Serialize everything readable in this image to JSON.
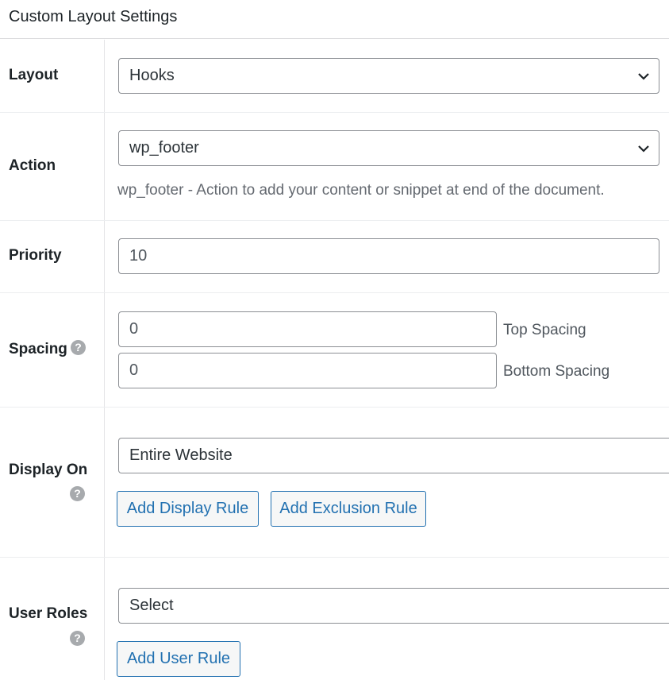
{
  "panel": {
    "title": "Custom Layout Settings"
  },
  "layout": {
    "label": "Layout",
    "value": "Hooks"
  },
  "action": {
    "label": "Action",
    "value": "wp_footer",
    "description": "wp_footer - Action to add your content or snippet at end of the document."
  },
  "priority": {
    "label": "Priority",
    "value": "10"
  },
  "spacing": {
    "label": "Spacing",
    "top_value": "0",
    "top_label": "Top Spacing",
    "bottom_value": "0",
    "bottom_label": "Bottom Spacing"
  },
  "display_on": {
    "label": "Display On",
    "value": "Entire Website",
    "add_display_rule": "Add Display Rule",
    "add_exclusion_rule": "Add Exclusion Rule"
  },
  "user_roles": {
    "label": "User Roles",
    "value": "Select",
    "add_user_rule": "Add User Rule"
  },
  "icons": {
    "help": "help-icon",
    "chevron": "chevron-down-icon"
  },
  "colors": {
    "accent": "#2271b1",
    "help_icon": "#a7aaad",
    "border": "#8c8f94"
  }
}
